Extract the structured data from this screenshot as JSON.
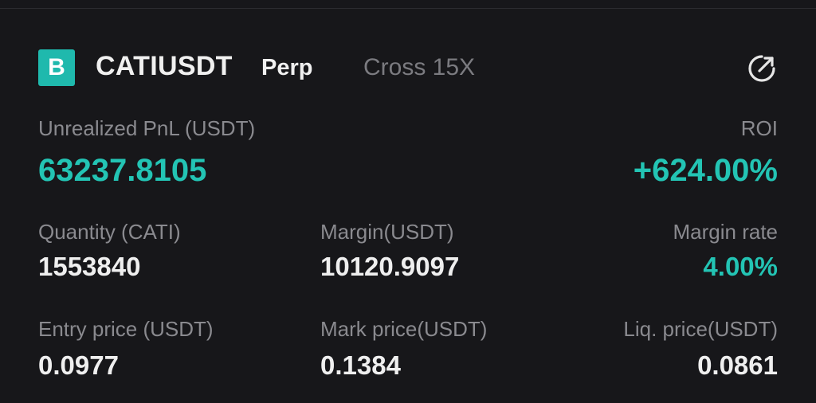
{
  "position": {
    "badge_letter": "B",
    "symbol": "CATIUSDT",
    "contract_type": "Perp",
    "margin_mode": "Cross 15X",
    "share_icon": "share-external-icon"
  },
  "metrics": {
    "unrealized_pnl_label": "Unrealized PnL (USDT)",
    "unrealized_pnl_value": "63237.8105",
    "roi_label": "ROI",
    "roi_value": "+624.00%",
    "quantity_label": "Quantity (CATI)",
    "quantity_value": "1553840",
    "margin_label": "Margin(USDT)",
    "margin_value": "10120.9097",
    "margin_rate_label": "Margin rate",
    "margin_rate_value": "4.00%",
    "entry_price_label": "Entry price (USDT)",
    "entry_price_value": "0.0977",
    "mark_price_label": "Mark price(USDT)",
    "mark_price_value": "0.1384",
    "liq_price_label": "Liq. price(USDT)",
    "liq_price_value": "0.0861"
  },
  "colors": {
    "accent": "#23c4b4",
    "badge": "#1fb9ad",
    "background": "#17171a"
  }
}
